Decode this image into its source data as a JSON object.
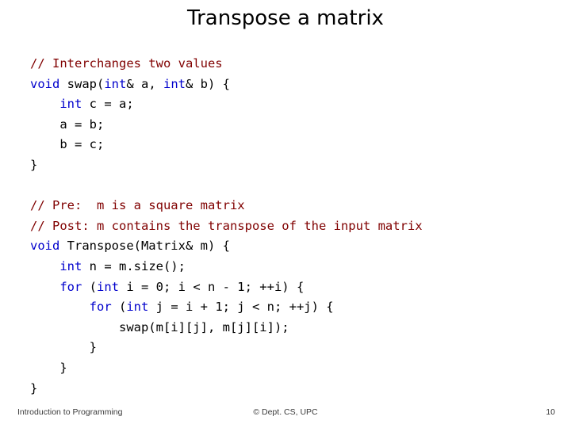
{
  "slide": {
    "title": "Transpose a matrix",
    "code_lines": [
      [
        {
          "t": "// Interchanges two values",
          "c": "cmt"
        }
      ],
      [
        {
          "t": "void",
          "c": "kw"
        },
        {
          "t": " swap(",
          "c": ""
        },
        {
          "t": "int",
          "c": "kw"
        },
        {
          "t": "& a, ",
          "c": ""
        },
        {
          "t": "int",
          "c": "kw"
        },
        {
          "t": "& b) {",
          "c": ""
        }
      ],
      [
        {
          "t": "    ",
          "c": ""
        },
        {
          "t": "int",
          "c": "kw"
        },
        {
          "t": " c = a;",
          "c": ""
        }
      ],
      [
        {
          "t": "    a = b;",
          "c": ""
        }
      ],
      [
        {
          "t": "    b = c;",
          "c": ""
        }
      ],
      [
        {
          "t": "}",
          "c": ""
        }
      ],
      [
        {
          "t": "",
          "c": ""
        }
      ],
      [
        {
          "t": "// Pre:  m is a square matrix",
          "c": "cmt"
        }
      ],
      [
        {
          "t": "// Post: m contains the transpose of the input matrix",
          "c": "cmt"
        }
      ],
      [
        {
          "t": "void",
          "c": "kw"
        },
        {
          "t": " Transpose(Matrix& m) {",
          "c": ""
        }
      ],
      [
        {
          "t": "    ",
          "c": ""
        },
        {
          "t": "int",
          "c": "kw"
        },
        {
          "t": " n = m.size();",
          "c": ""
        }
      ],
      [
        {
          "t": "    ",
          "c": ""
        },
        {
          "t": "for",
          "c": "kw"
        },
        {
          "t": " (",
          "c": ""
        },
        {
          "t": "int",
          "c": "kw"
        },
        {
          "t": " i = 0; i < n - 1; ++i) {",
          "c": ""
        }
      ],
      [
        {
          "t": "        ",
          "c": ""
        },
        {
          "t": "for",
          "c": "kw"
        },
        {
          "t": " (",
          "c": ""
        },
        {
          "t": "int",
          "c": "kw"
        },
        {
          "t": " j = i + 1; j < n; ++j) {",
          "c": ""
        }
      ],
      [
        {
          "t": "            swap(m[i][j], m[j][i]);",
          "c": ""
        }
      ],
      [
        {
          "t": "        }",
          "c": ""
        }
      ],
      [
        {
          "t": "    }",
          "c": ""
        }
      ],
      [
        {
          "t": "}",
          "c": ""
        }
      ]
    ],
    "footer": {
      "left": "Introduction to Programming",
      "center": "© Dept. CS, UPC",
      "right": "10"
    }
  },
  "colors": {
    "keyword": "#0000cc",
    "comment": "#800000",
    "text": "#000000",
    "footer": "#3b3b3b"
  }
}
